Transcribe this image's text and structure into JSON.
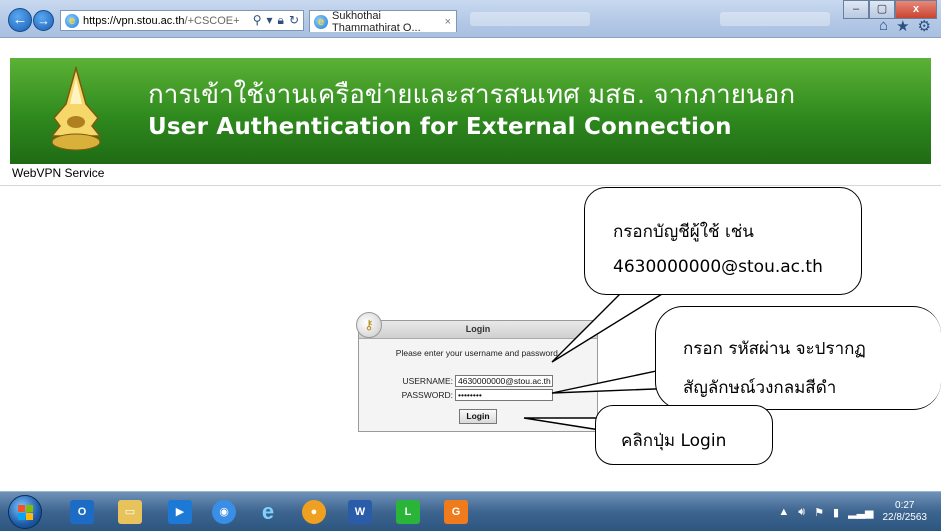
{
  "browser": {
    "url_host": "https://vpn.stou.ac.th",
    "url_path": "/+CSCOE+",
    "tab_title": "Sukhothai Thammathirat O...",
    "tab_close": "×",
    "window_controls": {
      "minimize": "–",
      "maximize": "▢",
      "close": "x"
    }
  },
  "banner": {
    "title_thai": "การเข้าใช้งานเครือข่ายและสารสนเทศ มสธ. จากภายนอก",
    "title_en": "User Authentication for External Connection",
    "service_label": "WebVPN Service"
  },
  "login": {
    "title": "Login",
    "message": "Please enter your username and password.",
    "username_label": "USERNAME:",
    "username_value": "4630000000@stou.ac.th",
    "password_label": "PASSWORD:",
    "password_value": "••••••••",
    "button_label": "Login"
  },
  "callouts": {
    "username_line1": "กรอกบัญชีผู้ใช้ เช่น",
    "username_line2": "4630000000@stou.ac.th",
    "password_line1": "กรอก รหัสผ่าน จะปรากฏ",
    "password_line2": "สัญลักษณ์วงกลมสีดำ",
    "login": "คลิกปุ่ม Login"
  },
  "taskbar": {
    "time": "0:27",
    "date": "22/8/2563"
  },
  "colors": {
    "banner_green": "#2f8a1e",
    "taskbar_blue": "#3d6590"
  }
}
